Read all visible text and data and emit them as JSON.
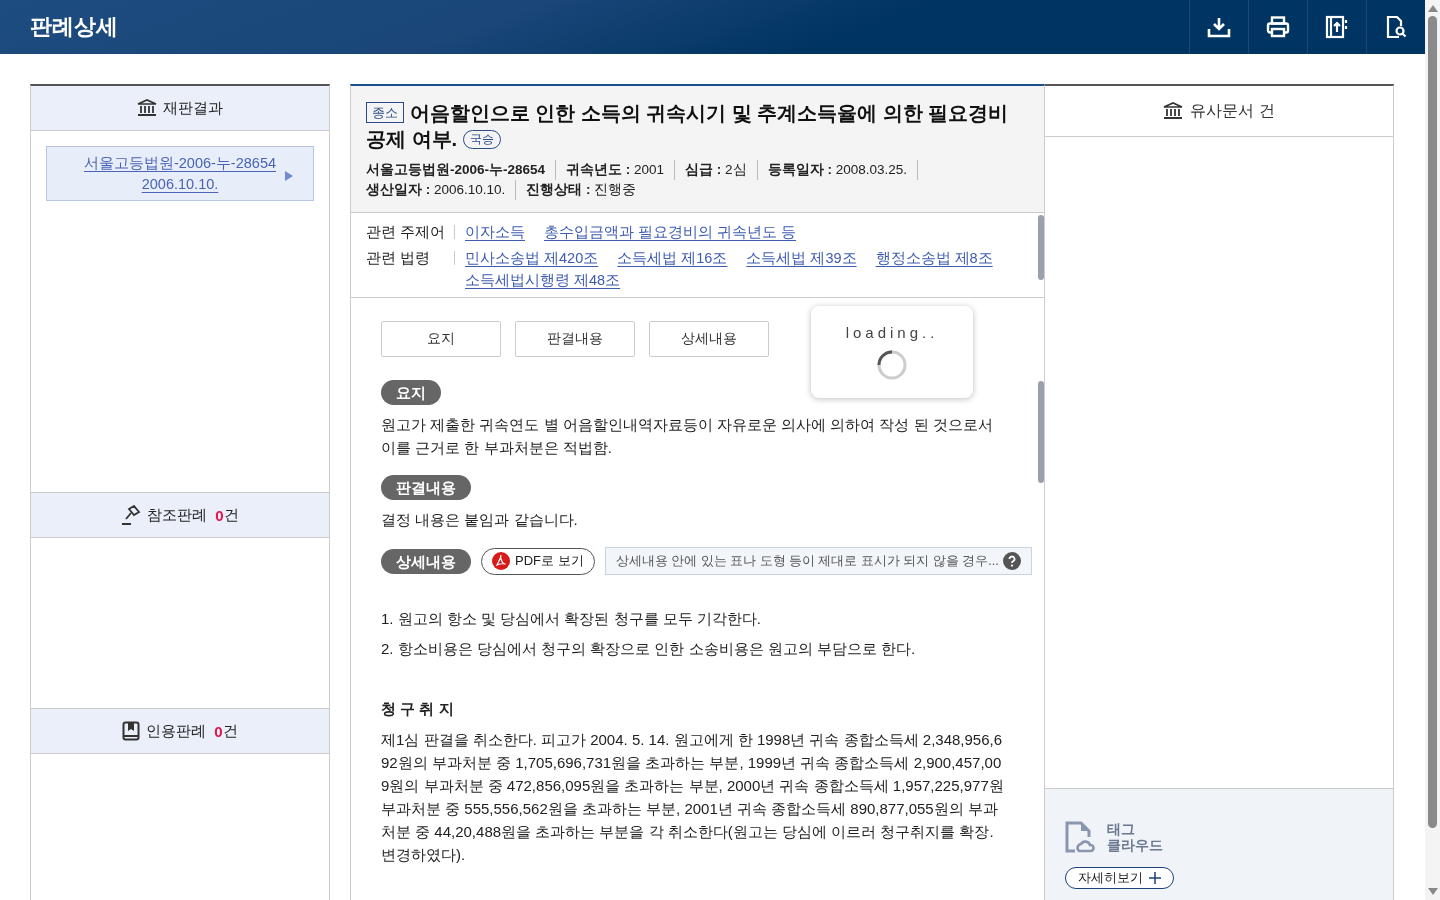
{
  "header": {
    "title": "판례상세"
  },
  "left": {
    "sections": [
      {
        "kind": "trial",
        "label": "재판결과",
        "cases": [
          {
            "court": "서울고등법원-2006-누-28654",
            "date": "2006.10.10."
          }
        ]
      },
      {
        "kind": "reference",
        "label": "참조판례",
        "count": "0",
        "unit": "건"
      },
      {
        "kind": "citation",
        "label": "인용판례",
        "count": "0",
        "unit": "건"
      }
    ]
  },
  "case": {
    "type_badge": "종소",
    "title": "어음할인으로 인한 소득의 귀속시기 및 추계소득율에 의한 필요경비 공제 여부.",
    "result_badge": "국승",
    "meta": [
      "**서울고등법원-2006-누-28654**",
      "**귀속년도 :** 2001",
      "**심급 :** 2심",
      "**등록일자 :** 2008.03.25.",
      "**생산일자 :** 2006.10.10.",
      "**진행상태 :** 진행중"
    ],
    "related": [
      {
        "label": "관련 주제어",
        "links": [
          "이자소득",
          "총수입금액과 필요경비의 귀속년도 등"
        ]
      },
      {
        "label": "관련 법령",
        "links": [
          "민사소송법 제420조",
          "소득세법 제16조",
          "소득세법 제39조",
          "행정소송법 제8조",
          "소득세법시행령 제48조"
        ]
      }
    ],
    "tabs": [
      "요지",
      "판결내용",
      "상세내용"
    ],
    "summary": {
      "label": "요지",
      "text": "원고가 제출한 귀속연도 별 어음할인내역자료등이 자유로운 의사에 의하여 작성 된 것으로서 이를 근거로 한 부과처분은 적법함."
    },
    "judgment": {
      "label": "판결내용",
      "text": "결정 내용은 붙임과 같습니다."
    },
    "details": {
      "label": "상세내용",
      "pdf_button": "PDF로 보기",
      "hint": "상세내용 안에 있는 표나 도형 등이 제대로 표시가 되지 않을 경우...",
      "orders": [
        "1. 원고의 항소 및 당심에서 확장된 청구를 모두 기각한다.",
        "2. 항소비용은 당심에서 청구의 확장으로 인한 소송비용은 원고의 부담으로 한다."
      ],
      "heading": "청 구 취 지",
      "paragraph": "제1심 판결을 취소한다. 피고가 2004. 5. 14. 원고에게 한 1998년 귀속 종합소득세 2,348,956,692원의 부과처분 중 1,705,696,731원을 초과하는 부분, 1999년 귀속 종합소득세 2,900,457,009원의 부과처분 중 472,856,095원을 초과하는 부분, 2000년 귀속 종합소득세 1,957,225,977원 부과처분 중 555,556,562원을 초과하는 부분, 2001년 귀속 종합소득세 890,877,055원의 부과처분 중 44,20,488원을 초과하는 부분을 각 취소한다(원고는 당심에 이르러 청구취지를 확장.변경하였다)."
    },
    "loading": {
      "text": "loading.."
    }
  },
  "right": {
    "similar_header": "유사문서 건",
    "tag_cloud": {
      "title_lines": [
        "태그",
        "클라우드"
      ],
      "more_button": "자세히보기"
    }
  }
}
